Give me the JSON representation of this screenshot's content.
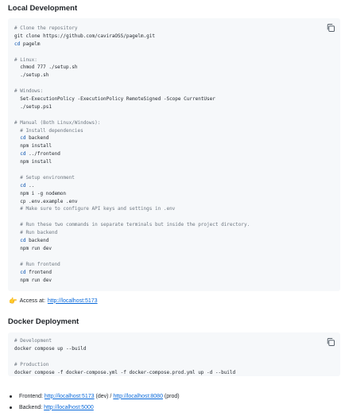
{
  "sections": {
    "local_title": "Local Development",
    "docker_title": "Docker Deployment"
  },
  "code1": {
    "copy_icon": "copy-icon",
    "lines": [
      {
        "kind": "cm",
        "text": "# Clone the repository"
      },
      {
        "kind": "plain",
        "text": "git clone https://github.com/caviraOSS/pagelm.git"
      },
      {
        "kind": "cd",
        "cmd": "cd",
        "rest": " pagelm"
      },
      {
        "kind": "blank",
        "text": ""
      },
      {
        "kind": "cm",
        "text": "# Linux:"
      },
      {
        "kind": "plain",
        "text": "  chmod 777 ./setup.sh"
      },
      {
        "kind": "plain",
        "text": "  ./setup.sh"
      },
      {
        "kind": "blank",
        "text": ""
      },
      {
        "kind": "cm",
        "text": "# Windows:"
      },
      {
        "kind": "plain",
        "text": "  Set-ExecutionPolicy -ExecutionPolicy RemoteSigned -Scope CurrentUser"
      },
      {
        "kind": "plain",
        "text": "  ./setup.ps1"
      },
      {
        "kind": "blank",
        "text": ""
      },
      {
        "kind": "cm",
        "text": "# Manual (Both Linux/Windows):"
      },
      {
        "kind": "cm",
        "text": "  # Install dependencies"
      },
      {
        "kind": "cd",
        "cmd": "  cd",
        "rest": " backend"
      },
      {
        "kind": "plain",
        "text": "  npm install"
      },
      {
        "kind": "cd",
        "cmd": "  cd",
        "rest": " ../frontend"
      },
      {
        "kind": "plain",
        "text": "  npm install"
      },
      {
        "kind": "blank",
        "text": ""
      },
      {
        "kind": "cm",
        "text": "  # Setup environment"
      },
      {
        "kind": "cd",
        "cmd": "  cd",
        "rest": " .."
      },
      {
        "kind": "plain",
        "text": "  npm i -g nodemon"
      },
      {
        "kind": "plain",
        "text": "  cp .env.example .env"
      },
      {
        "kind": "cm",
        "text": "  # Make sure to configure API keys and settings in .env"
      },
      {
        "kind": "blank",
        "text": ""
      },
      {
        "kind": "cm",
        "text": "  # Run these two commands in separate terminals but inside the project directory."
      },
      {
        "kind": "cm",
        "text": "  # Run backend"
      },
      {
        "kind": "cd",
        "cmd": "  cd",
        "rest": " backend"
      },
      {
        "kind": "plain",
        "text": "  npm run dev"
      },
      {
        "kind": "blank",
        "text": ""
      },
      {
        "kind": "cm",
        "text": "  # Run frontend"
      },
      {
        "kind": "cd",
        "cmd": "  cd",
        "rest": " frontend"
      },
      {
        "kind": "plain",
        "text": "  npm run dev"
      }
    ]
  },
  "access": {
    "icon": "pointing-hand-icon",
    "label": "Access at:",
    "link": "http://localhost:5173"
  },
  "code2": {
    "copy_icon": "copy-icon",
    "lines": [
      {
        "kind": "cm",
        "text": "# Development"
      },
      {
        "kind": "plain",
        "text": "docker compose up --build"
      },
      {
        "kind": "blank",
        "text": ""
      },
      {
        "kind": "cm",
        "text": "# Production"
      },
      {
        "kind": "plain",
        "text": "docker compose -f docker-compose.yml -f docker-compose.prod.yml up -d --build"
      }
    ]
  },
  "bullets": {
    "frontend_label": "Frontend:",
    "frontend_link_dev": "http://localhost:5173",
    "dev_note": " (dev) / ",
    "frontend_link_prod": "http://localhost:8080",
    "prod_note": " (prod)",
    "backend_label": "Backend:",
    "backend_link": "http://localhost:5000"
  },
  "colors": {
    "code_bg": "#f6f8fa",
    "link": "#0969da",
    "comment": "#6e7781",
    "keyword": "#0550ae"
  }
}
